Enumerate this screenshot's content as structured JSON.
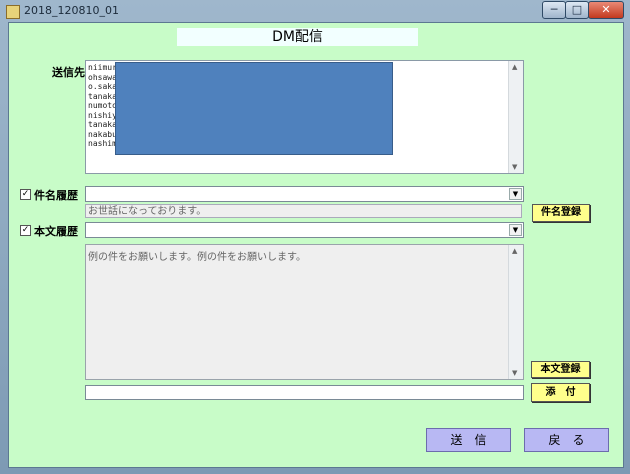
{
  "window": {
    "title": "2018_120810_01",
    "min_label": "─",
    "max_label": "□",
    "close_label": "✕"
  },
  "heading": "DM配信",
  "recipients": {
    "label": "送信先",
    "lines": [
      "niimura",
      "ohsawa",
      "o.sakai",
      "tanaka",
      "numoto",
      "nishiyo",
      "tanaka",
      "nakabu",
      "nashimo"
    ]
  },
  "subject_history": {
    "check": "✓",
    "label": "件名履歴",
    "value": "",
    "text": "お世話になっております。",
    "register_label": "件名登録"
  },
  "body_history": {
    "check": "✓",
    "label": "本文履歴",
    "value": "",
    "text": "例の件をお願いします。例の件をお願いします。",
    "register_label": "本文登録"
  },
  "attachment": {
    "value": "",
    "button_label": "添　付"
  },
  "actions": {
    "send_label": "送　信",
    "back_label": "戻　る"
  },
  "icons": {
    "dropdown": "chevron-down-icon",
    "scroll_up": "scroll-up-icon",
    "scroll_down": "scroll-down-icon"
  }
}
